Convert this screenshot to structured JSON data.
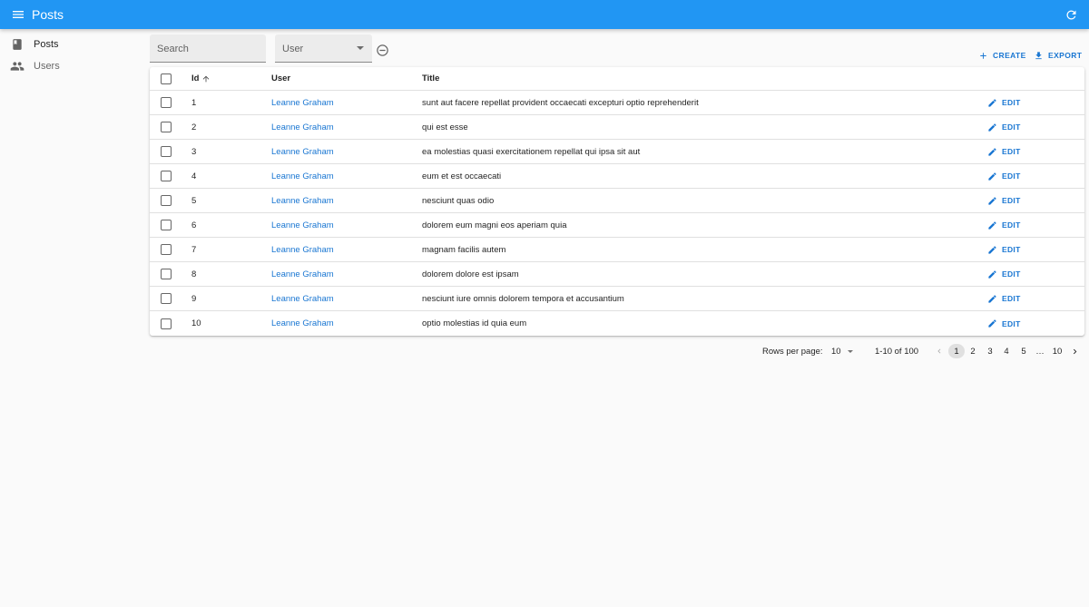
{
  "appbar": {
    "title": "Posts",
    "menu_icon": "menu-icon",
    "refresh_icon": "refresh-icon",
    "color": "#2196f3"
  },
  "sidebar": {
    "items": [
      {
        "label": "Posts",
        "icon": "book-icon"
      },
      {
        "label": "Users",
        "icon": "people-icon"
      }
    ]
  },
  "filters": {
    "search_placeholder": "Search",
    "user_label": "User"
  },
  "toolbar": {
    "create_label": "CREATE",
    "export_label": "EXPORT"
  },
  "table": {
    "headers": {
      "id": "Id",
      "user": "User",
      "title": "Title"
    },
    "edit_label": "EDIT",
    "rows": [
      {
        "id": "1",
        "user": "Leanne Graham",
        "title": "sunt aut facere repellat provident occaecati excepturi optio reprehenderit"
      },
      {
        "id": "2",
        "user": "Leanne Graham",
        "title": "qui est esse"
      },
      {
        "id": "3",
        "user": "Leanne Graham",
        "title": "ea molestias quasi exercitationem repellat qui ipsa sit aut"
      },
      {
        "id": "4",
        "user": "Leanne Graham",
        "title": "eum et est occaecati"
      },
      {
        "id": "5",
        "user": "Leanne Graham",
        "title": "nesciunt quas odio"
      },
      {
        "id": "6",
        "user": "Leanne Graham",
        "title": "dolorem eum magni eos aperiam quia"
      },
      {
        "id": "7",
        "user": "Leanne Graham",
        "title": "magnam facilis autem"
      },
      {
        "id": "8",
        "user": "Leanne Graham",
        "title": "dolorem dolore est ipsam"
      },
      {
        "id": "9",
        "user": "Leanne Graham",
        "title": "nesciunt iure omnis dolorem tempora et accusantium"
      },
      {
        "id": "10",
        "user": "Leanne Graham",
        "title": "optio molestias id quia eum"
      }
    ]
  },
  "pagination": {
    "rows_per_page_label": "Rows per page:",
    "rows_per_page_value": "10",
    "range": "1-10 of 100",
    "pages": [
      "1",
      "2",
      "3",
      "4",
      "5",
      "…",
      "10"
    ],
    "current_page": "1"
  }
}
